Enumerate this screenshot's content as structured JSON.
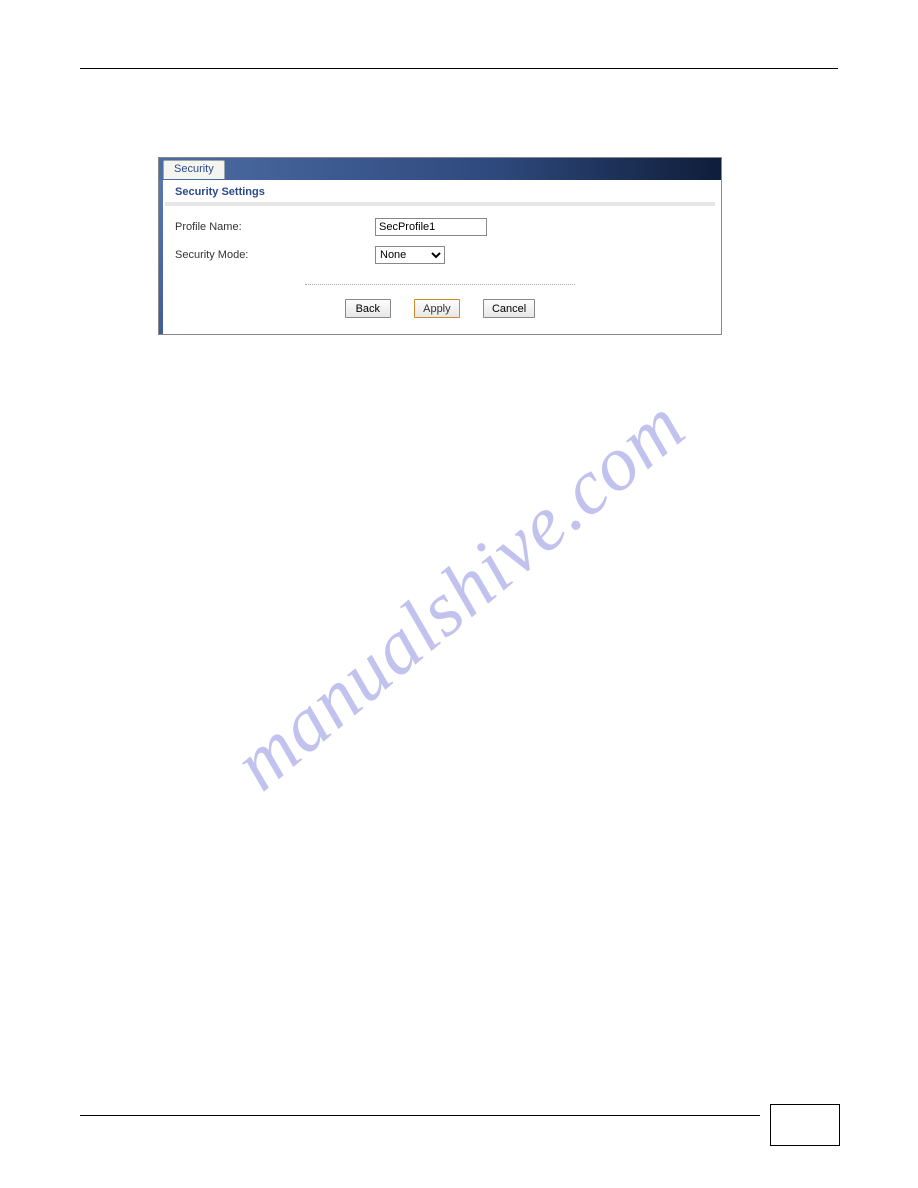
{
  "watermark": "manualshive.com",
  "screenshot": {
    "tab_label": "Security",
    "section_title": "Security Settings",
    "fields": {
      "profile_name_label": "Profile Name:",
      "profile_name_value": "SecProfile1",
      "security_mode_label": "Security Mode:",
      "security_mode_value": "None"
    },
    "buttons": {
      "back": "Back",
      "apply": "Apply",
      "cancel": "Cancel"
    }
  }
}
